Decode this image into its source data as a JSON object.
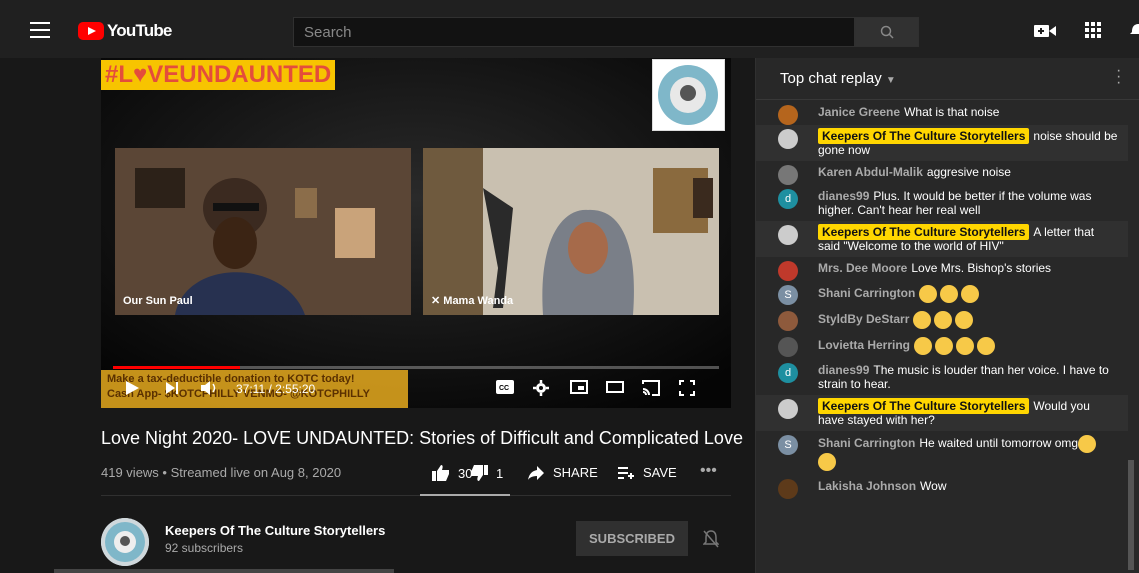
{
  "app": {
    "logo_text": "YouTube"
  },
  "search": {
    "placeholder": "Search"
  },
  "video": {
    "hashtag": "#L♥VEUNDAUNTED",
    "left_label": "Our Sun Paul",
    "right_label": "Mama Wanda",
    "ticker_line1": "Make a tax-deductible donation to KOTC today!",
    "ticker_line2": "Cash App- $KOTCPHILLY  VENMO- @KOTCPHILLY",
    "time": "37:11 / 2:55:20",
    "progress": 0.21
  },
  "info": {
    "title": "Love Night 2020- LOVE UNDAUNTED: Stories of Difficult and Complicated Love",
    "meta": "419 views • Streamed live on Aug 8, 2020",
    "likes": "30",
    "dislikes": "1",
    "share": "SHARE",
    "save": "SAVE"
  },
  "channel": {
    "name": "Keepers Of The Culture Storytellers",
    "subs": "92 subscribers",
    "subscribe_label": "SUBSCRIBED"
  },
  "chat": {
    "header": "Top chat replay",
    "messages": [
      {
        "author": "Janice Greene",
        "text": "What is that noise",
        "owner": false,
        "avatar": "",
        "color": "#b5651d"
      },
      {
        "author": "Keepers Of The Culture Storytellers",
        "text": "noise should be gone now",
        "owner": true,
        "avatar": "",
        "color": "#ccc"
      },
      {
        "author": "Karen Abdul-Malik",
        "text": "aggresive noise",
        "owner": false,
        "avatar": "",
        "color": "#777"
      },
      {
        "author": "dianes99",
        "text": "Plus. It would be better if the volume was higher. Can't hear her real well",
        "owner": false,
        "avatar": "d",
        "color": "#1e8fa0"
      },
      {
        "author": "Keepers Of The Culture Storytellers",
        "text": "A letter that said \"Welcome to the world of HIV\"",
        "owner": true,
        "avatar": "",
        "color": "#ccc"
      },
      {
        "author": "Mrs. Dee Moore",
        "text": "Love Mrs. Bishop's stories",
        "owner": false,
        "avatar": "",
        "color": "#c0392b"
      },
      {
        "author": "Shani Carrington",
        "text": "",
        "owner": false,
        "avatar": "S",
        "color": "#7b8fa3",
        "emojis": 3
      },
      {
        "author": "StyldBy DeStarr",
        "text": "",
        "owner": false,
        "avatar": "",
        "color": "#8e5a3c",
        "emojis": 3
      },
      {
        "author": "Lovietta Herring",
        "text": "",
        "owner": false,
        "avatar": "",
        "color": "#555",
        "emojis": 4
      },
      {
        "author": "dianes99",
        "text": "The music is louder than her voice. I have to strain to hear.",
        "owner": false,
        "avatar": "d",
        "color": "#1e8fa0"
      },
      {
        "author": "Keepers Of The Culture Storytellers",
        "text": "Would you have stayed with her?",
        "owner": true,
        "avatar": "",
        "color": "#ccc"
      },
      {
        "author": "Shani Carrington",
        "text": "He waited until tomorrow omg",
        "owner": false,
        "avatar": "S",
        "color": "#7b8fa3",
        "emojis": 2
      },
      {
        "author": "Lakisha Johnson",
        "text": "Wow",
        "owner": false,
        "avatar": "",
        "color": "#5d3a1a"
      }
    ]
  }
}
